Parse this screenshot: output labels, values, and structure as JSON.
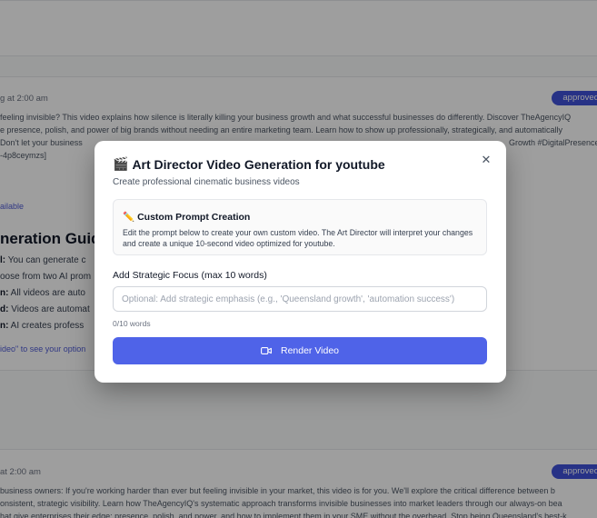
{
  "background": {
    "card1": {
      "meta": "g at 2:00 am",
      "badge": "approved",
      "lines": [
        " feeling invisible? This video explains how silence is literally killing your business growth and what successful businesses do differently. Discover TheAgencyIQ",
        "e presence, polish, and power of big brands without needing an entire marketing team. Learn how to show up professionally, strategically, and automatically",
        " Don't let your business",
        "-4p8ceymzs]"
      ],
      "line2_tail": "Growth #DigitalPresence",
      "available": "ailable",
      "guide_title": "neration Guid",
      "guide_rows": [
        {
          "key": "l:",
          "text": " You can generate c"
        },
        {
          "key": "",
          "text": "oose from two AI prom"
        },
        {
          "key": "n:",
          "text": " All videos are auto"
        },
        {
          "key": "d:",
          "text": " Videos are automat"
        },
        {
          "key": "n:",
          "text": " AI creates profess"
        }
      ],
      "footer_link": "ideo\" to see your option"
    },
    "card2": {
      "meta": "at 2:00 am",
      "badge": "approved",
      "lines": [
        " business owners: If you're working harder than ever but feeling invisible in your market, this video is for you. We'll explore the critical difference between b",
        "onsistent, strategic visibility. Learn how TheAgencyIQ's systematic approach transforms invisible businesses into market leaders through our always-on bea",
        "hat give enterprises their edge: presence, polish, and power, and how to implement them in your SME without the overhead. Stop being Queensland's best-k"
      ]
    }
  },
  "modal": {
    "title_emoji": "🎬",
    "title": "Art Director Video Generation for youtube",
    "subtitle": "Create professional cinematic business videos",
    "close_glyph": "✕",
    "info": {
      "emoji": "✏️",
      "title": "Custom Prompt Creation",
      "text": "Edit the prompt below to create your own custom video. The Art Director will interpret your changes and create a unique 10-second video optimized for youtube."
    },
    "focus_label": "Add Strategic Focus (max 10 words)",
    "focus_placeholder": "Optional: Add strategic emphasis (e.g., 'Queensland growth', 'automation success')",
    "focus_value": "",
    "word_count": "0/10 words",
    "render_label": "Render Video",
    "render_icon": "video-camera-icon",
    "accent": "#4f63e8"
  }
}
